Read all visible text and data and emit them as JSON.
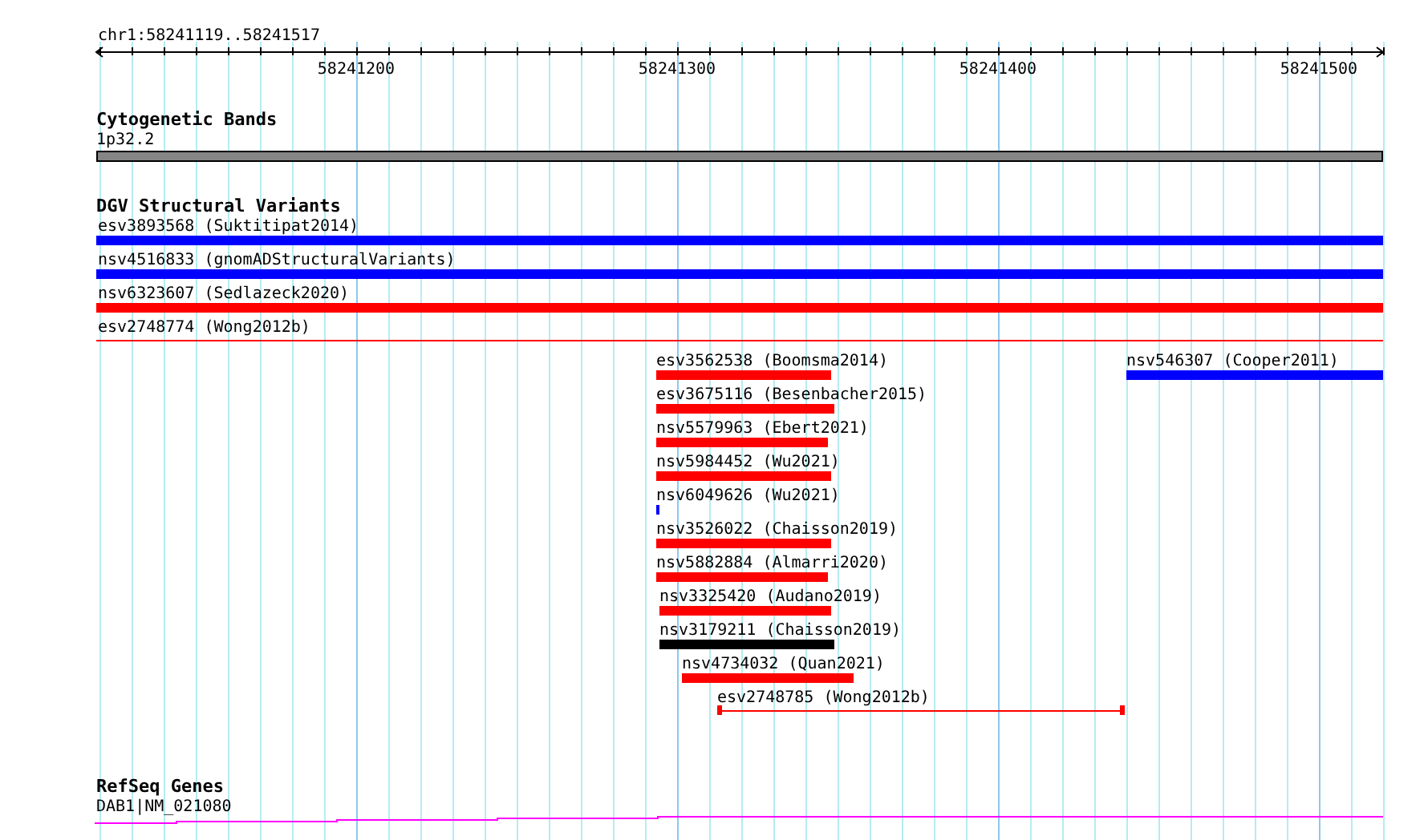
{
  "locus": "chr1:58241119..58241517",
  "axis": {
    "ticks": [
      "58241200",
      "58241300",
      "58241400",
      "58241500"
    ]
  },
  "tracks": [
    {
      "kind": "cytoband",
      "title": "Cytogenetic Bands",
      "band": {
        "label": "1p32.2"
      }
    },
    {
      "kind": "variants",
      "title": "DGV Structural Variants",
      "features": [
        {
          "label": "esv3893568 (Suktitipat2014)",
          "color": "#0000ff",
          "kind": "bar"
        },
        {
          "label": "nsv4516833 (gnomADStructuralVariants)",
          "color": "#0000ff",
          "kind": "bar"
        },
        {
          "label": "nsv6323607 (Sedlazeck2020)",
          "color": "#ff0000",
          "kind": "bar"
        },
        {
          "label": "esv2748774 (Wong2012b)",
          "color": "#ff0000",
          "kind": "line"
        },
        {
          "label": "esv3562538 (Boomsma2014)",
          "color": "#ff0000",
          "kind": "bar"
        },
        {
          "label": "nsv546307 (Cooper2011)",
          "color": "#0000ff",
          "kind": "bar"
        },
        {
          "label": "esv3675116 (Besenbacher2015)",
          "color": "#ff0000",
          "kind": "bar"
        },
        {
          "label": "nsv5579963 (Ebert2021)",
          "color": "#ff0000",
          "kind": "bar"
        },
        {
          "label": "nsv5984452 (Wu2021)",
          "color": "#ff0000",
          "kind": "bar"
        },
        {
          "label": "nsv6049626 (Wu2021)",
          "color": "#0000ff",
          "kind": "bar"
        },
        {
          "label": "nsv3526022 (Chaisson2019)",
          "color": "#ff0000",
          "kind": "bar"
        },
        {
          "label": "nsv5882884 (Almarri2020)",
          "color": "#ff0000",
          "kind": "bar"
        },
        {
          "label": "nsv3325420 (Audano2019)",
          "color": "#ff0000",
          "kind": "bar"
        },
        {
          "label": "nsv3179211 (Chaisson2019)",
          "color": "#000000",
          "kind": "bar"
        },
        {
          "label": "nsv4734032 (Quan2021)",
          "color": "#ff0000",
          "kind": "bar"
        },
        {
          "label": "esv2748785 (Wong2012b)",
          "color": "#ff0000",
          "kind": "capped"
        }
      ]
    },
    {
      "kind": "gene",
      "title": "RefSeq Genes",
      "gene": {
        "label": "DAB1|NM_021080"
      }
    }
  ]
}
